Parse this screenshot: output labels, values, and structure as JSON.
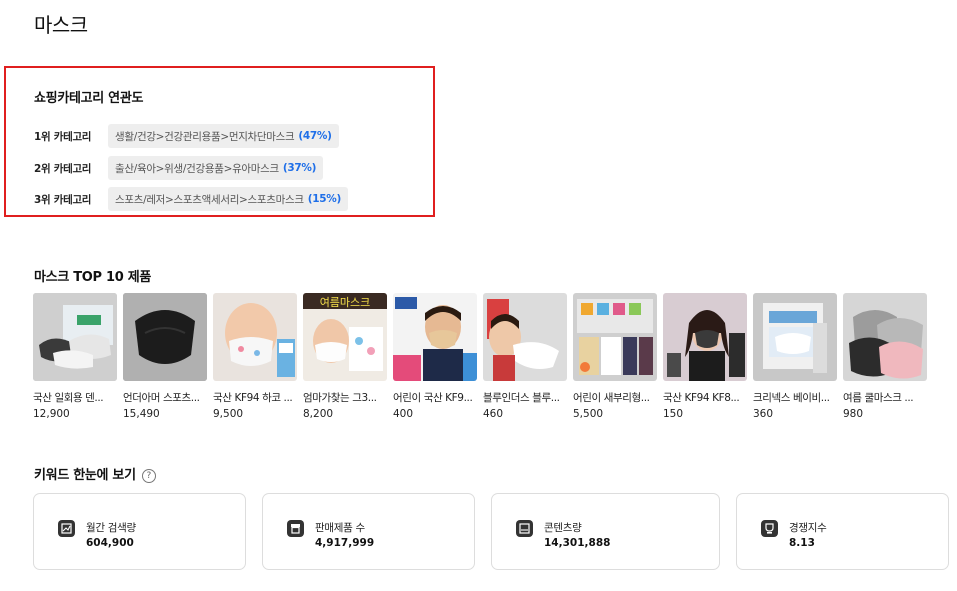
{
  "page": {
    "title": "마스크"
  },
  "category_relevance": {
    "title": "쇼핑카테고리 연관도",
    "rows": [
      {
        "rank": "1위 카테고리",
        "path": "생활/건강>건강관리용품>먼지차단마스크",
        "percent": "(47%)"
      },
      {
        "rank": "2위 카테고리",
        "path": "출산/육아>위생/건강용품>유아마스크",
        "percent": "(37%)"
      },
      {
        "rank": "3위 카테고리",
        "path": "스포츠/레저>스포츠액세서리>스포츠마스크",
        "percent": "(15%)"
      }
    ]
  },
  "top_products": {
    "title": "마스크 TOP 10 제품",
    "items": [
      {
        "name": "국산 일회용 덴...",
        "price": "12,900"
      },
      {
        "name": "언더아머 스포츠...",
        "price": "15,490"
      },
      {
        "name": "국산 KF94 하코 ...",
        "price": "9,500"
      },
      {
        "name": "엄마가찾는 그3...",
        "price": "8,200",
        "thumb_text": "여름마스크"
      },
      {
        "name": "어린이 국산 KF9...",
        "price": "400"
      },
      {
        "name": "블루인더스 블루...",
        "price": "460"
      },
      {
        "name": "어린이 새부리형...",
        "price": "5,500"
      },
      {
        "name": "국산 KF94 KF8...",
        "price": "150"
      },
      {
        "name": "크리넥스 베이비...",
        "price": "360"
      },
      {
        "name": "여름 쿨마스크 ...",
        "price": "980"
      }
    ]
  },
  "keyword_overview": {
    "title": "키워드 한눈에 보기",
    "help_glyph": "?",
    "stats": [
      {
        "label": "월간 검색량",
        "value": "604,900",
        "icon": "chart-icon"
      },
      {
        "label": "판매제품 수",
        "value": "4,917,999",
        "icon": "box-icon"
      },
      {
        "label": "콘텐츠량",
        "value": "14,301,888",
        "icon": "document-icon"
      },
      {
        "label": "경쟁지수",
        "value": "8.13",
        "icon": "trophy-icon"
      }
    ]
  },
  "colors": {
    "highlight_border": "#e01f1f",
    "percent_blue": "#1f6fe8"
  }
}
